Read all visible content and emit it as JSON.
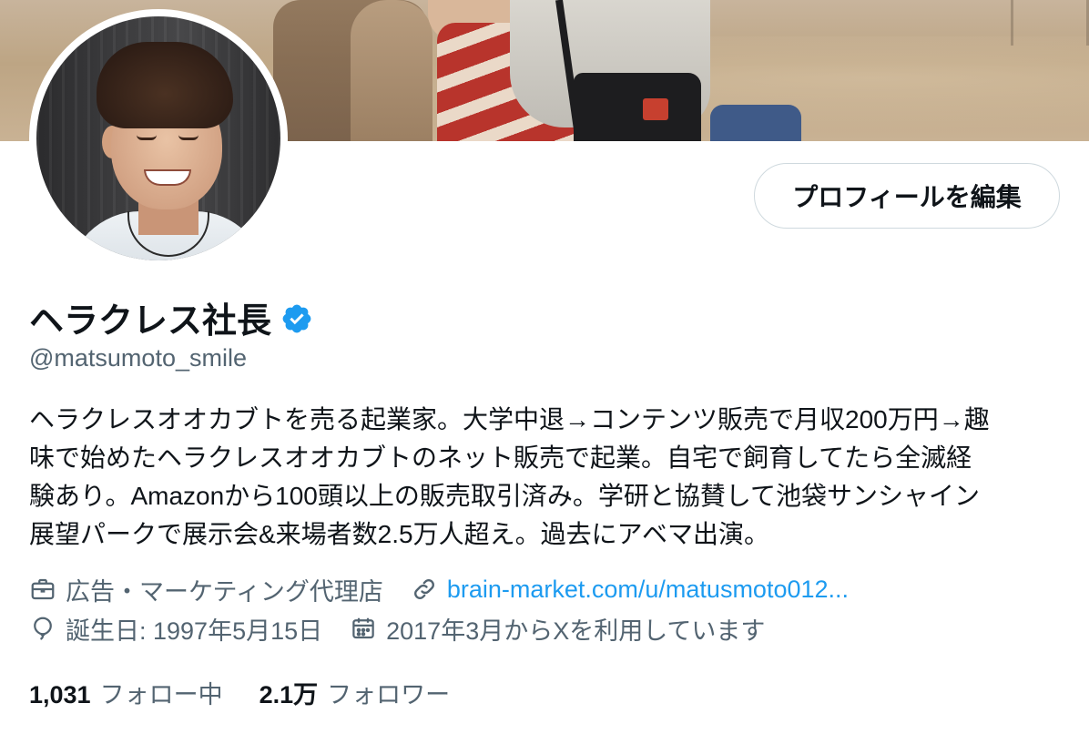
{
  "profile": {
    "display_name": "ヘラクレス社長",
    "handle": "@matsumoto_smile",
    "edit_button_label": "プロフィールを編集",
    "bio_lines": [
      "ヘラクレスオオカブトを売る起業家。大学中退→コンテンツ販売で月収200万円→趣",
      "味で始めたヘラクレスオオカブトのネット販売で起業。自宅で飼育してたら全滅経",
      "験あり。Amazonから100頭以上の販売取引済み。学研と協賛して池袋サンシャイン",
      "展望パークで展示会&来場者数2.5万人超え。過去にアベマ出演。"
    ],
    "category": "広告・マーケティング代理店",
    "website": "brain-market.com/u/matusmoto012...",
    "birthday": "誕生日: 1997年5月15日",
    "joined": "2017年3月からXを利用しています",
    "following_count": "1,031",
    "following_label": "フォロー中",
    "followers_count": "2.1万",
    "followers_label": "フォロワー"
  },
  "icons": {
    "verified": "verified-badge-icon",
    "category": "briefcase-icon",
    "website": "link-icon",
    "birthday": "balloon-icon",
    "joined": "calendar-icon"
  },
  "colors": {
    "accent": "#1d9bf0",
    "text_primary": "#0f1419",
    "text_secondary": "#536471",
    "border": "#cfd9de"
  }
}
